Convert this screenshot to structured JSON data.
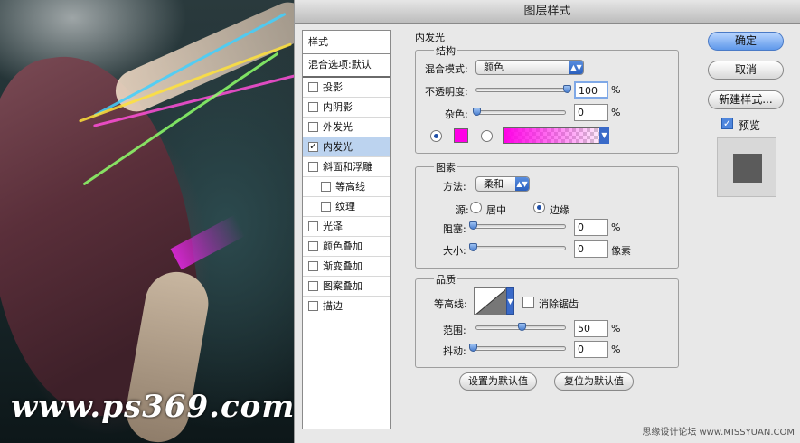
{
  "watermark": "www.ps369.com",
  "dialog": {
    "title": "图层样式",
    "credit": "思缘设计论坛 www.MISSYUAN.COM"
  },
  "styles": {
    "header": "样式",
    "blend": "混合选项:默认",
    "items": [
      {
        "label": "投影",
        "checked": false
      },
      {
        "label": "内阴影",
        "checked": false
      },
      {
        "label": "外发光",
        "checked": false
      },
      {
        "label": "内发光",
        "checked": true
      },
      {
        "label": "斜面和浮雕",
        "checked": false
      },
      {
        "label": "等高线",
        "checked": false
      },
      {
        "label": "纹理",
        "checked": false
      },
      {
        "label": "光泽",
        "checked": false
      },
      {
        "label": "颜色叠加",
        "checked": false
      },
      {
        "label": "渐变叠加",
        "checked": false
      },
      {
        "label": "图案叠加",
        "checked": false
      },
      {
        "label": "描边",
        "checked": false
      }
    ]
  },
  "panel": {
    "title": "内发光",
    "structure": {
      "label": "结构",
      "blend_mode_label": "混合模式:",
      "blend_mode_value": "颜色",
      "opacity_label": "不透明度:",
      "opacity_value": "100",
      "noise_label": "杂色:",
      "noise_value": "0",
      "percent": "%",
      "color": "#ff00e6"
    },
    "elements": {
      "label": "图素",
      "technique_label": "方法:",
      "technique_value": "柔和",
      "source_label": "源:",
      "center_label": "居中",
      "edge_label": "边缘",
      "choke_label": "阻塞:",
      "choke_value": "0",
      "size_label": "大小:",
      "size_value": "0",
      "percent": "%",
      "px": "像素"
    },
    "quality": {
      "label": "品质",
      "contour_label": "等高线:",
      "antialias_label": "消除锯齿",
      "range_label": "范围:",
      "range_value": "50",
      "jitter_label": "抖动:",
      "jitter_value": "0",
      "percent": "%"
    },
    "set_default": "设置为默认值",
    "reset_default": "复位为默认值"
  },
  "buttons": {
    "ok": "确定",
    "cancel": "取消",
    "new_style": "新建样式...",
    "preview": "预览"
  }
}
